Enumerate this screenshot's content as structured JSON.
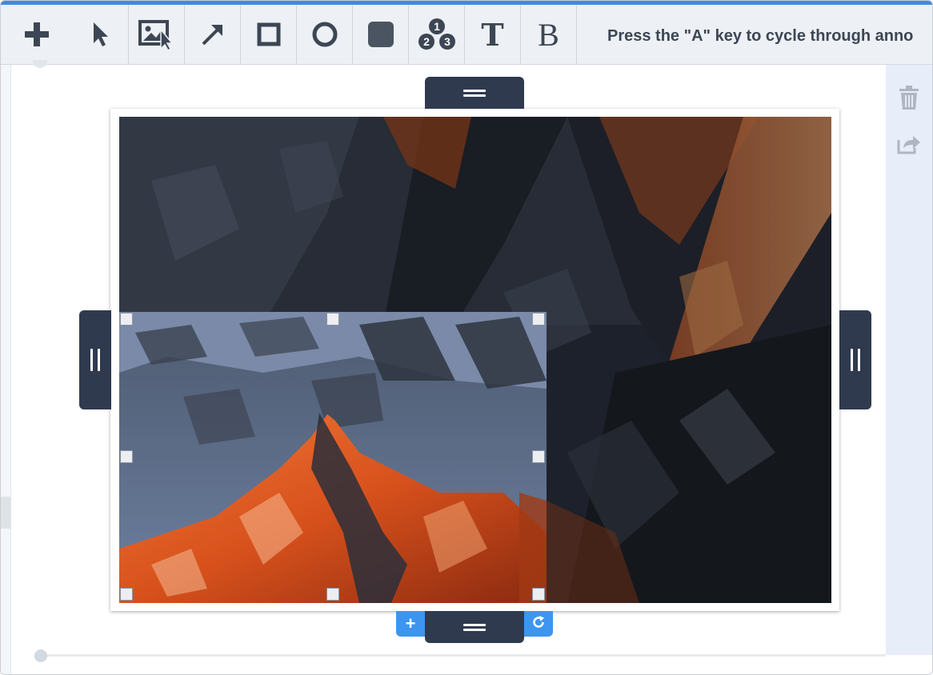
{
  "toolbar": {
    "tools": [
      {
        "name": "add",
        "icon": "plus-icon"
      },
      {
        "name": "select",
        "icon": "cursor-arrow-icon"
      },
      {
        "name": "image-select",
        "icon": "image-cursor-icon"
      },
      {
        "name": "arrow",
        "icon": "arrow-icon"
      },
      {
        "name": "rectangle",
        "icon": "square-outline-icon"
      },
      {
        "name": "ellipse",
        "icon": "circle-outline-icon"
      },
      {
        "name": "filled-rectangle",
        "icon": "filled-square-icon"
      },
      {
        "name": "numbered-steps",
        "icon": "numbered-badges-icon",
        "badges": [
          "1",
          "2",
          "3"
        ]
      },
      {
        "name": "text",
        "icon": "text-t-icon",
        "label": "T"
      },
      {
        "name": "bold-text",
        "icon": "text-b-icon",
        "label": "B"
      }
    ],
    "hint": "Press the \"A\" key to cycle through anno"
  },
  "side_panel": {
    "icons": [
      "trash-icon",
      "share-icon"
    ]
  },
  "canvas": {
    "image_icon": "mountain-photo",
    "add_label": "+",
    "rotate_icon": "rotate-icon"
  },
  "colors": {
    "accent": "#3d95f0",
    "handle": "#2f3a4e",
    "toolbar_bg": "#edf0f4",
    "top_line": "#3d8be0"
  }
}
